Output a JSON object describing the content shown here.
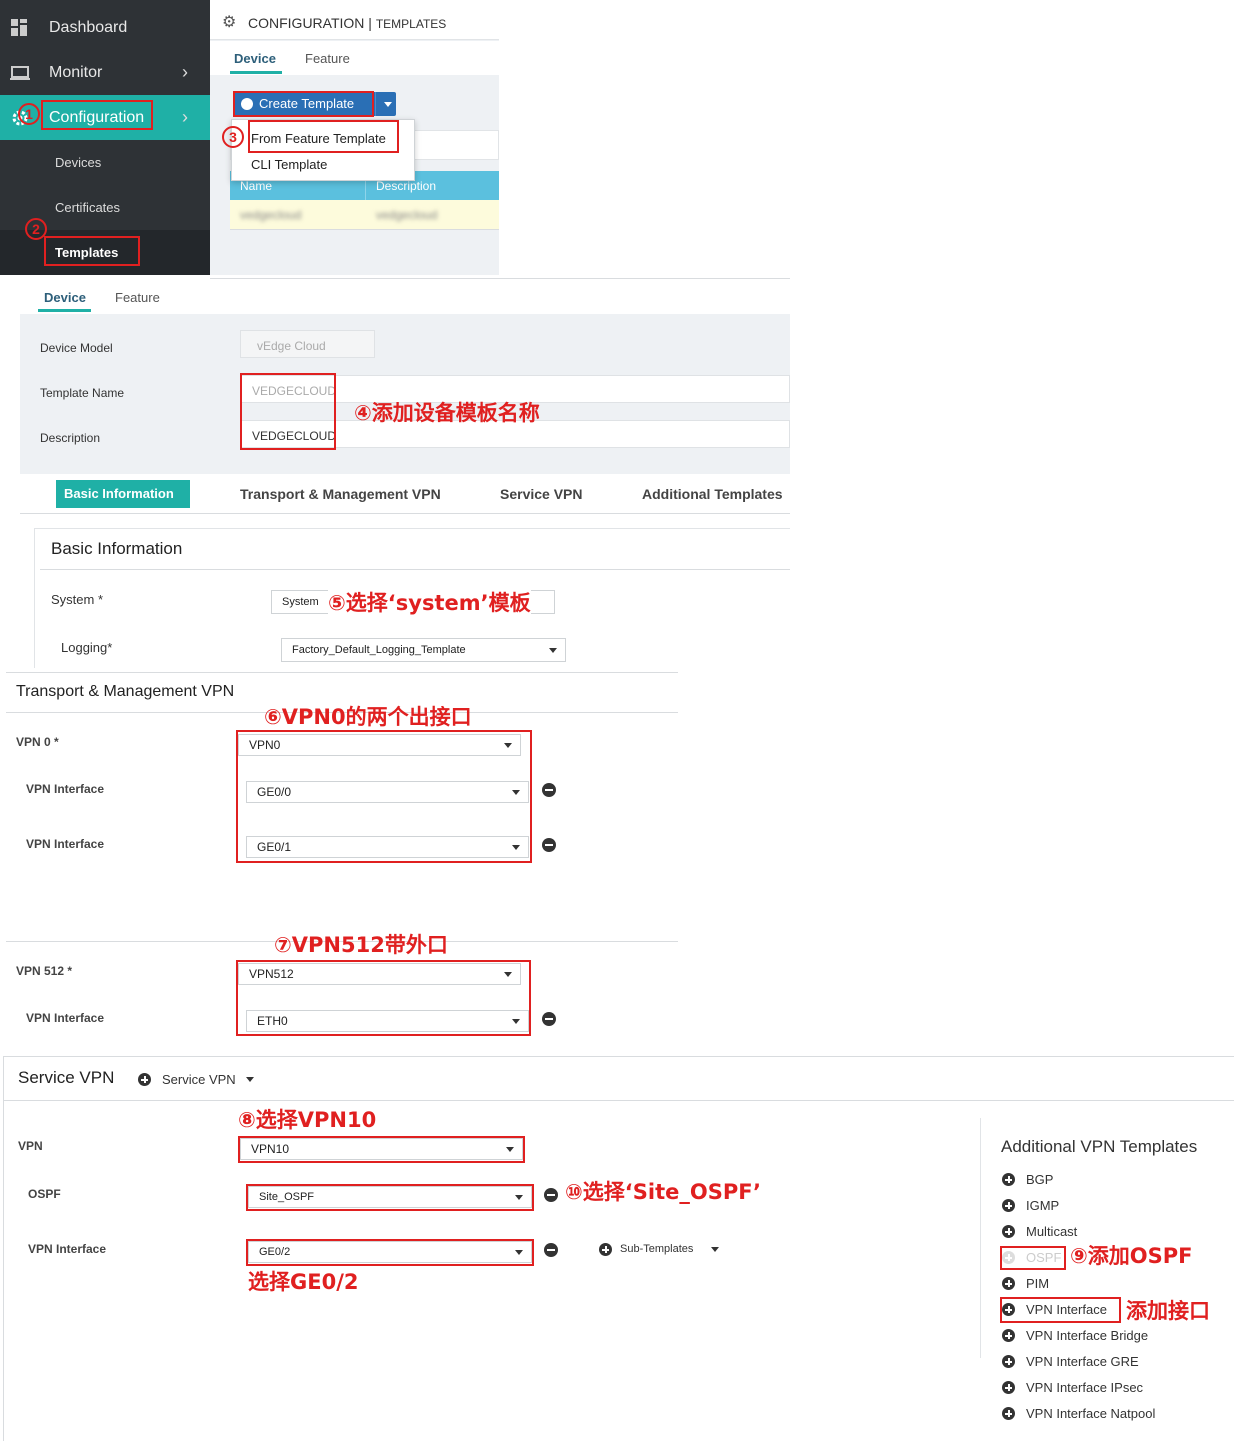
{
  "sidebar": {
    "items": [
      {
        "label": "Dashboard"
      },
      {
        "label": "Monitor"
      },
      {
        "label": "Configuration"
      }
    ],
    "subitems": [
      {
        "label": "Devices"
      },
      {
        "label": "Certificates"
      },
      {
        "label": "Templates"
      }
    ]
  },
  "top": {
    "breadcrumb_main": "CONFIGURATION",
    "breadcrumb_sep": " | ",
    "breadcrumb_sub": "TEMPLATES",
    "tabs": [
      "Device",
      "Feature"
    ],
    "create_button": "Create Template",
    "dropdown": [
      "From Feature Template",
      "CLI Template"
    ],
    "table_headers": [
      "Name",
      "Description"
    ],
    "table_row_blurred": [
      "vedgecloud",
      "vedgecloud"
    ]
  },
  "form": {
    "tabs": [
      "Device",
      "Feature"
    ],
    "device_model_label": "Device Model",
    "device_model_value": "vEdge Cloud",
    "template_name_label": "Template Name",
    "template_name_value": "VEDGECLOUD",
    "description_label": "Description",
    "description_value": "VEDGECLOUD",
    "section_tabs": [
      "Basic Information",
      "Transport & Management VPN",
      "Service VPN",
      "Additional Templates"
    ]
  },
  "basic": {
    "title": "Basic Information",
    "system_label": "System *",
    "system_value": "System",
    "logging_label": "Logging*",
    "logging_value": "Factory_Default_Logging_Template"
  },
  "transport": {
    "title": "Transport & Management VPN",
    "vpn0_label": "VPN 0 *",
    "vpn0_value": "VPN0",
    "iface_label": "VPN Interface",
    "iface1_value": "GE0/0",
    "iface2_value": "GE0/1",
    "vpn512_label": "VPN 512 *",
    "vpn512_value": "VPN512",
    "iface3_value": "ETH0"
  },
  "service": {
    "title": "Service VPN",
    "add_label": "Service VPN",
    "vpn_label": "VPN",
    "vpn_value": "VPN10",
    "ospf_label": "OSPF",
    "ospf_value": "Site_OSPF",
    "iface_label": "VPN Interface",
    "iface_value": "GE0/2",
    "sub_templates": "Sub-Templates"
  },
  "additional": {
    "title": "Additional VPN Templates",
    "items": [
      "BGP",
      "IGMP",
      "Multicast",
      "OSPF",
      "PIM",
      "VPN Interface",
      "VPN Interface Bridge",
      "VPN Interface GRE",
      "VPN Interface IPsec",
      "VPN Interface Natpool"
    ]
  },
  "annotations": {
    "n1": "1",
    "n2": "2",
    "n3": "3",
    "a4": "④添加设备模板名称",
    "a5": "⑤选择‘system’模板",
    "a6": "⑥VPN0的两个出接口",
    "a7": "⑦VPN512带外口",
    "a8": "⑧选择VPN10",
    "a9": "⑨添加OSPF",
    "a10": "⑩选择‘Site_OSPF’",
    "a_ge": "选择GE0/2",
    "a_iface": "添加接口"
  },
  "colors": {
    "sidebar_bg": "#2e3236",
    "accent_teal": "#1fb0a6",
    "button_blue": "#2a6fb5",
    "table_header": "#5bc0de",
    "annotation_red": "#e02020"
  }
}
